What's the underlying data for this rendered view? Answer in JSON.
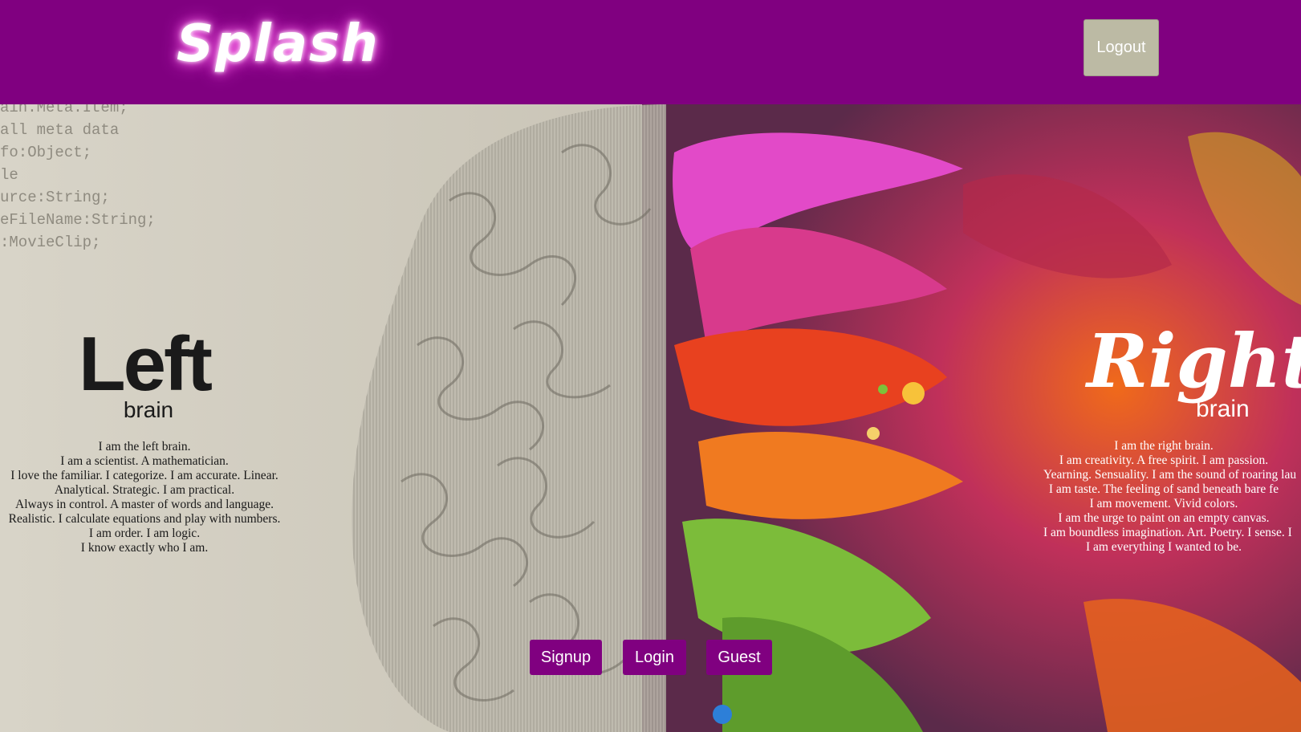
{
  "header": {
    "logo_text": "Splash",
    "logout_label": "Logout"
  },
  "hero": {
    "left": {
      "title": "Left",
      "subtitle": "brain",
      "lines": [
        "I am the left brain.",
        "I am a scientist. A mathematician.",
        "I love the familiar. I categorize. I am accurate. Linear.",
        "Analytical. Strategic. I am practical.",
        "Always in control. A master of words and language.",
        "Realistic. I calculate equations and play with numbers.",
        "I am order. I am logic.",
        "I know exactly who I am."
      ]
    },
    "right": {
      "title": "Right",
      "subtitle": "brain",
      "lines": [
        "I am the right brain.",
        "I am creativity. A free spirit. I am passion.",
        "Yearning. Sensuality. I am the sound of roaring lau",
        "I am taste. The feeling of sand beneath bare fe",
        "I am movement. Vivid colors.",
        "I am the urge to paint on an empty canvas.",
        "I am boundless imagination. Art. Poetry. I sense. I",
        "I am everything I wanted to be."
      ]
    },
    "code_lines": [
      "ain.Meta.Item;",
      "all meta data",
      "fo:Object;",
      "le",
      "urce:String;",
      "eFileName:String;",
      ":MovieClip;"
    ]
  },
  "actions": {
    "signup_label": "Signup",
    "login_label": "Login",
    "guest_label": "Guest"
  },
  "colors": {
    "brand": "#800080",
    "logout_bg": "#bcbaa4"
  }
}
